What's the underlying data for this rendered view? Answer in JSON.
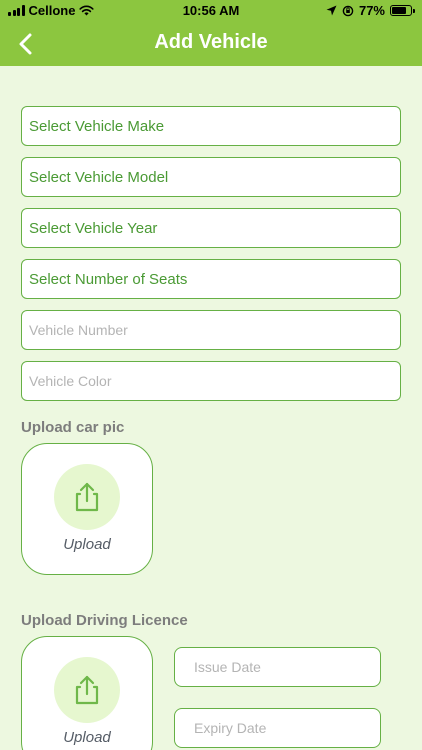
{
  "status_bar": {
    "carrier": "Cellone",
    "time": "10:56 AM",
    "battery": "77%",
    "battery_level": 0.77
  },
  "header": {
    "title": "Add Vehicle",
    "back_icon": "chevron-left-icon"
  },
  "form": {
    "vehicle_make": "Select Vehicle Make",
    "vehicle_model": "Select Vehicle Model",
    "vehicle_year": "Select Vehicle Year",
    "number_of_seats": "Select Number of Seats",
    "vehicle_number_placeholder": "Vehicle Number",
    "vehicle_color_placeholder": "Vehicle Color"
  },
  "car_pic": {
    "heading": "Upload car pic",
    "upload_label": "Upload"
  },
  "driving_licence": {
    "heading": "Upload Driving Licence",
    "upload_label": "Upload",
    "issue_date_placeholder": "Issue Date",
    "expiry_date_placeholder": "Expiry Date"
  },
  "colors": {
    "accent": "#8cc63f",
    "border": "#66b045",
    "background": "#edf8e0",
    "select_text": "#4a9a34"
  }
}
